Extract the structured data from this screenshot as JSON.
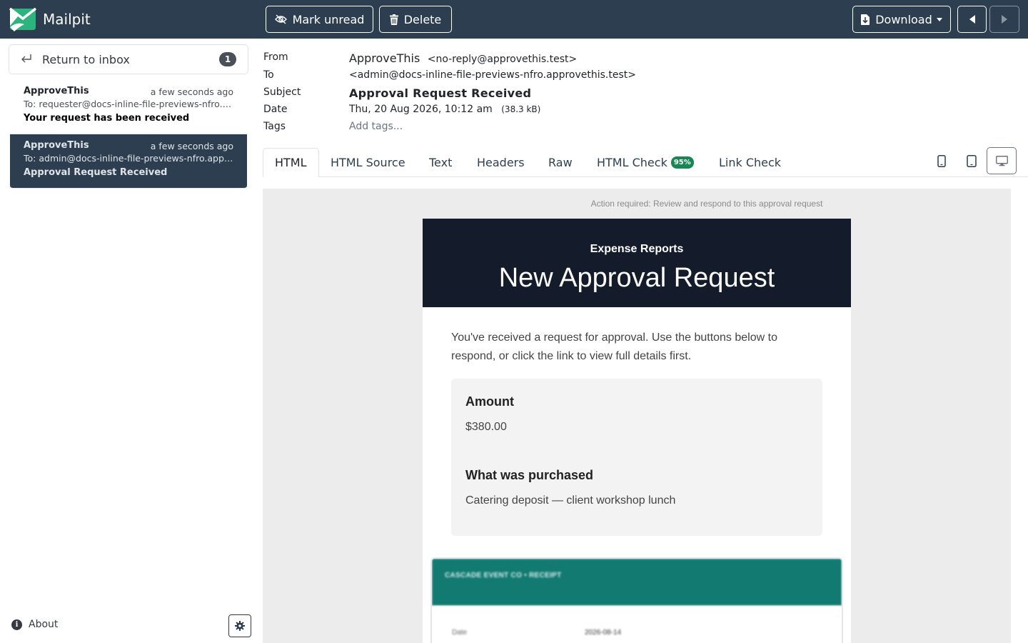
{
  "app": {
    "name": "Mailpit"
  },
  "toolbar": {
    "mark_unread": "Mark unread",
    "delete": "Delete",
    "download": "Download"
  },
  "sidebar": {
    "return_label": "Return to inbox",
    "unread_count": "1",
    "about": "About",
    "messages": [
      {
        "from": "ApproveThis",
        "time": "a few seconds ago",
        "to": "To: requester@docs-inline-file-previews-nfro.approvethis.test",
        "subject": "Your request has been received",
        "active": false
      },
      {
        "from": "ApproveThis",
        "time": "a few seconds ago",
        "to": "To: admin@docs-inline-file-previews-nfro.approvethis.test",
        "subject": "Approval Request Received",
        "active": true
      }
    ]
  },
  "headers": {
    "from_label": "From",
    "to_label": "To",
    "subject_label": "Subject",
    "date_label": "Date",
    "tags_label": "Tags",
    "from_name": "ApproveThis",
    "from_address": "<no-reply@approvethis.test>",
    "to_address": "<admin@docs-inline-file-previews-nfro.approvethis.test>",
    "subject": "Approval Request Received",
    "date": "Thu, 20 Aug 2026, 10:12 am",
    "size": "(38.3 kB)",
    "tags_placeholder": "Add tags..."
  },
  "tabs": [
    {
      "label": "HTML",
      "active": true
    },
    {
      "label": "HTML Source",
      "active": false
    },
    {
      "label": "Text",
      "active": false
    },
    {
      "label": "Headers",
      "active": false
    },
    {
      "label": "Raw",
      "active": false
    },
    {
      "label": "HTML Check",
      "active": false,
      "badge": "95%"
    },
    {
      "label": "Link Check",
      "active": false
    }
  ],
  "devices": [
    "phone-icon",
    "tablet-icon",
    "desktop-icon"
  ],
  "email": {
    "preheader": "Action required: Review and respond to this approval request",
    "kicker": "Expense Reports",
    "title": "New Approval Request",
    "intro": "You've received a request for approval. Use the buttons below to respond, or click the link to view full details first.",
    "amount_label": "Amount",
    "amount_value": "$380.00",
    "purchase_label": "What was purchased",
    "purchase_value": "Catering deposit — client workshop lunch",
    "attachment": {
      "header": "CASCADE EVENT CO • RECEIPT",
      "row_key": "Date",
      "row_value": "2026-08-14"
    }
  },
  "colors": {
    "topbar": "#2c3e50",
    "email_header": "#141b2a",
    "attachment_header": "#137a72",
    "check_badge": "#198754"
  }
}
